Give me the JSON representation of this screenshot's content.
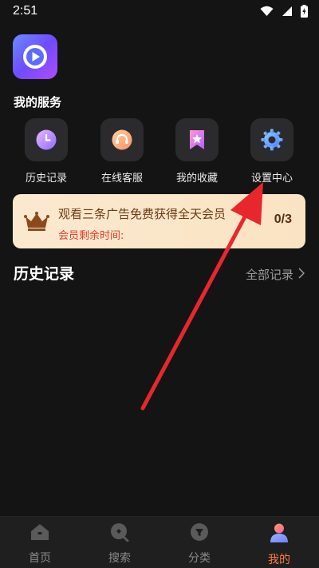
{
  "status_bar": {
    "time": "2:51",
    "icons": [
      "wifi-icon",
      "signal-icon",
      "battery-charging-icon"
    ]
  },
  "app": {
    "logo_icon": "play-button-logo"
  },
  "services": {
    "title": "我的服务",
    "items": [
      {
        "label": "历史记录",
        "icon": "clock-icon"
      },
      {
        "label": "在线客服",
        "icon": "headset-icon"
      },
      {
        "label": "我的收藏",
        "icon": "star-bookmark-icon"
      },
      {
        "label": "设置中心",
        "icon": "gear-icon"
      }
    ]
  },
  "promo": {
    "title": "观看三条广告免费获得全天会员",
    "subtitle": "会员剩余时间:",
    "count": "0/3",
    "icon": "crown-icon"
  },
  "history": {
    "title": "历史记录",
    "all_link": "全部记录"
  },
  "bottom_nav": {
    "items": [
      {
        "label": "首页",
        "icon": "home-icon",
        "active": false
      },
      {
        "label": "搜索",
        "icon": "search-icon",
        "active": false
      },
      {
        "label": "分类",
        "icon": "category-icon",
        "active": false
      },
      {
        "label": "我的",
        "icon": "profile-icon",
        "active": true
      }
    ]
  },
  "colors": {
    "background": "#141414",
    "accent": "#ff7a45",
    "annotation_arrow": "#e8272d",
    "promo_bg": "#fbe9cf"
  }
}
